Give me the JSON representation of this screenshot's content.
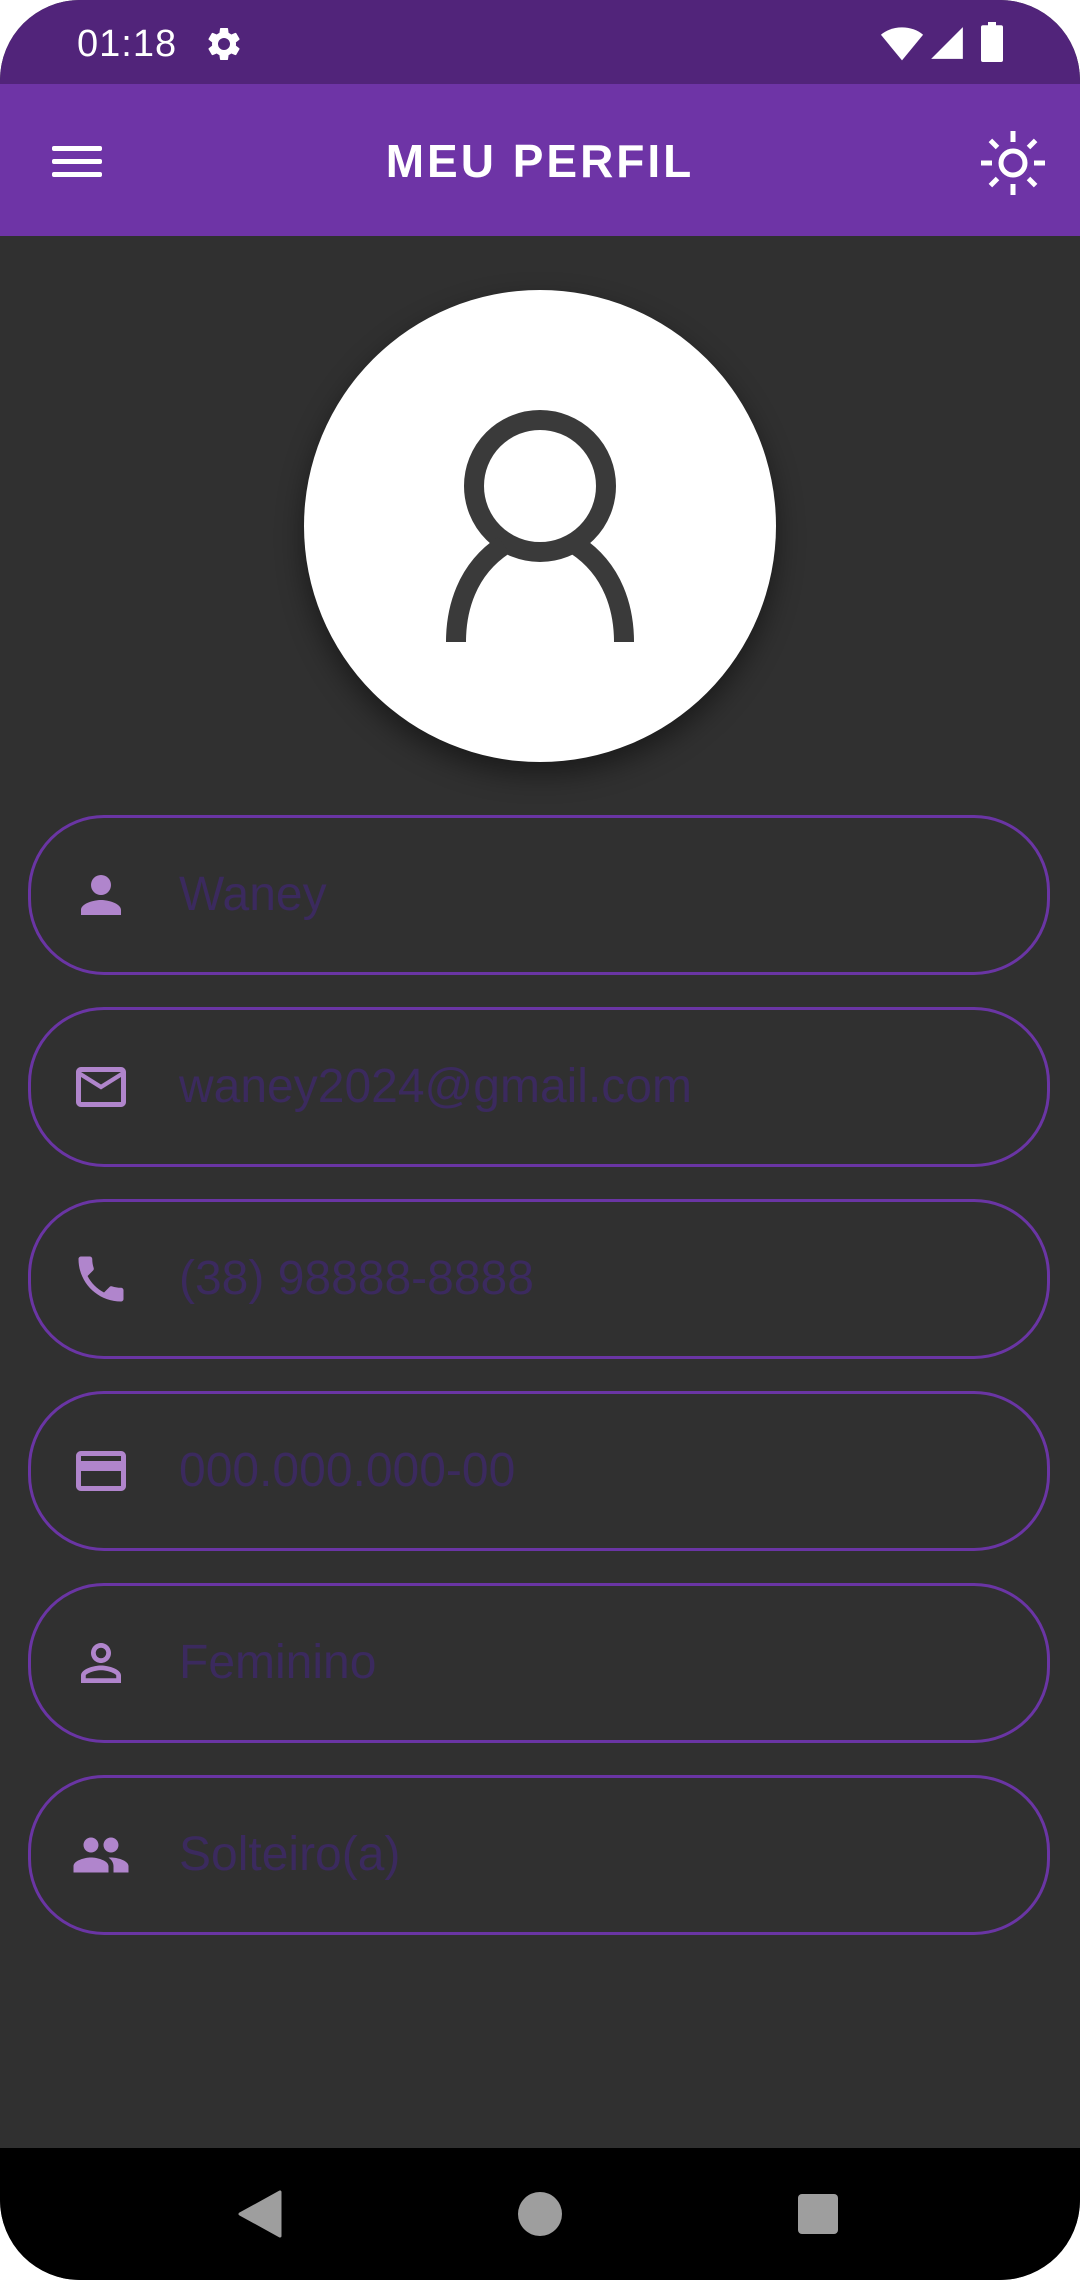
{
  "status_bar": {
    "time": "01:18",
    "icons": [
      "gear-icon",
      "wifi-icon",
      "signal-icon",
      "battery-icon"
    ]
  },
  "app_bar": {
    "title": "MEU PERFIL",
    "left_icon": "menu-icon",
    "right_icon": "sun-icon"
  },
  "avatar": {
    "icon": "user-outline-icon"
  },
  "fields": [
    {
      "icon": "person-icon",
      "value": "Waney"
    },
    {
      "icon": "mail-icon",
      "value": "waney2024@gmail.com"
    },
    {
      "icon": "phone-icon",
      "value": "(38) 98888-8888"
    },
    {
      "icon": "card-icon",
      "value": "000.000.000-00"
    },
    {
      "icon": "person-outline-icon",
      "value": "Feminino"
    },
    {
      "icon": "group-icon",
      "value": "Solteiro(a)"
    }
  ],
  "colors": {
    "status_bar": "#51247a",
    "app_bar": "#6e34a6",
    "background": "#303030",
    "field_border": "#6a35a4",
    "field_icon": "#b085cc",
    "field_text": "#3b2a5e"
  },
  "nav_bar": {
    "icons": [
      "back-icon",
      "home-icon",
      "recents-icon"
    ]
  }
}
